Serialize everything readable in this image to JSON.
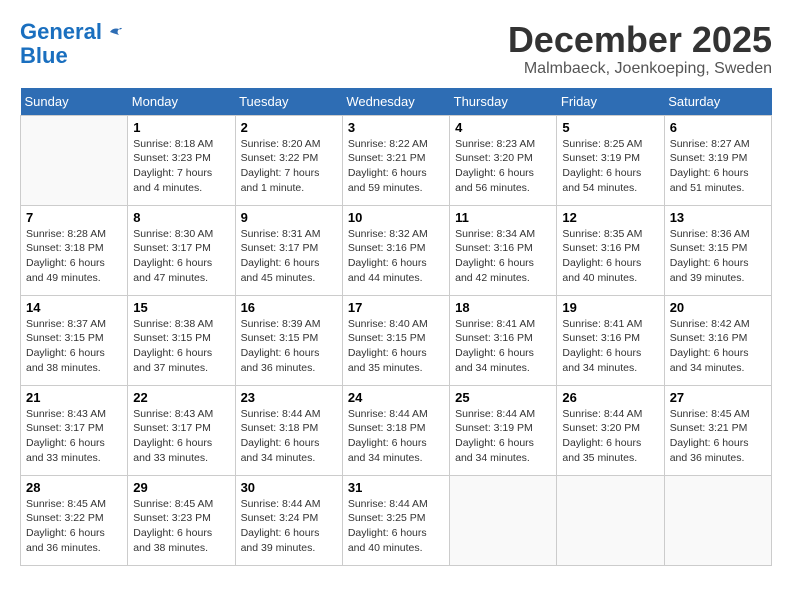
{
  "header": {
    "logo_line1": "General",
    "logo_line2": "Blue",
    "month": "December 2025",
    "location": "Malmbaeck, Joenkoeping, Sweden"
  },
  "days_of_week": [
    "Sunday",
    "Monday",
    "Tuesday",
    "Wednesday",
    "Thursday",
    "Friday",
    "Saturday"
  ],
  "weeks": [
    [
      {
        "day": "",
        "info": ""
      },
      {
        "day": "1",
        "info": "Sunrise: 8:18 AM\nSunset: 3:23 PM\nDaylight: 7 hours\nand 4 minutes."
      },
      {
        "day": "2",
        "info": "Sunrise: 8:20 AM\nSunset: 3:22 PM\nDaylight: 7 hours\nand 1 minute."
      },
      {
        "day": "3",
        "info": "Sunrise: 8:22 AM\nSunset: 3:21 PM\nDaylight: 6 hours\nand 59 minutes."
      },
      {
        "day": "4",
        "info": "Sunrise: 8:23 AM\nSunset: 3:20 PM\nDaylight: 6 hours\nand 56 minutes."
      },
      {
        "day": "5",
        "info": "Sunrise: 8:25 AM\nSunset: 3:19 PM\nDaylight: 6 hours\nand 54 minutes."
      },
      {
        "day": "6",
        "info": "Sunrise: 8:27 AM\nSunset: 3:19 PM\nDaylight: 6 hours\nand 51 minutes."
      }
    ],
    [
      {
        "day": "7",
        "info": "Sunrise: 8:28 AM\nSunset: 3:18 PM\nDaylight: 6 hours\nand 49 minutes."
      },
      {
        "day": "8",
        "info": "Sunrise: 8:30 AM\nSunset: 3:17 PM\nDaylight: 6 hours\nand 47 minutes."
      },
      {
        "day": "9",
        "info": "Sunrise: 8:31 AM\nSunset: 3:17 PM\nDaylight: 6 hours\nand 45 minutes."
      },
      {
        "day": "10",
        "info": "Sunrise: 8:32 AM\nSunset: 3:16 PM\nDaylight: 6 hours\nand 44 minutes."
      },
      {
        "day": "11",
        "info": "Sunrise: 8:34 AM\nSunset: 3:16 PM\nDaylight: 6 hours\nand 42 minutes."
      },
      {
        "day": "12",
        "info": "Sunrise: 8:35 AM\nSunset: 3:16 PM\nDaylight: 6 hours\nand 40 minutes."
      },
      {
        "day": "13",
        "info": "Sunrise: 8:36 AM\nSunset: 3:15 PM\nDaylight: 6 hours\nand 39 minutes."
      }
    ],
    [
      {
        "day": "14",
        "info": "Sunrise: 8:37 AM\nSunset: 3:15 PM\nDaylight: 6 hours\nand 38 minutes."
      },
      {
        "day": "15",
        "info": "Sunrise: 8:38 AM\nSunset: 3:15 PM\nDaylight: 6 hours\nand 37 minutes."
      },
      {
        "day": "16",
        "info": "Sunrise: 8:39 AM\nSunset: 3:15 PM\nDaylight: 6 hours\nand 36 minutes."
      },
      {
        "day": "17",
        "info": "Sunrise: 8:40 AM\nSunset: 3:15 PM\nDaylight: 6 hours\nand 35 minutes."
      },
      {
        "day": "18",
        "info": "Sunrise: 8:41 AM\nSunset: 3:16 PM\nDaylight: 6 hours\nand 34 minutes."
      },
      {
        "day": "19",
        "info": "Sunrise: 8:41 AM\nSunset: 3:16 PM\nDaylight: 6 hours\nand 34 minutes."
      },
      {
        "day": "20",
        "info": "Sunrise: 8:42 AM\nSunset: 3:16 PM\nDaylight: 6 hours\nand 34 minutes."
      }
    ],
    [
      {
        "day": "21",
        "info": "Sunrise: 8:43 AM\nSunset: 3:17 PM\nDaylight: 6 hours\nand 33 minutes."
      },
      {
        "day": "22",
        "info": "Sunrise: 8:43 AM\nSunset: 3:17 PM\nDaylight: 6 hours\nand 33 minutes."
      },
      {
        "day": "23",
        "info": "Sunrise: 8:44 AM\nSunset: 3:18 PM\nDaylight: 6 hours\nand 34 minutes."
      },
      {
        "day": "24",
        "info": "Sunrise: 8:44 AM\nSunset: 3:18 PM\nDaylight: 6 hours\nand 34 minutes."
      },
      {
        "day": "25",
        "info": "Sunrise: 8:44 AM\nSunset: 3:19 PM\nDaylight: 6 hours\nand 34 minutes."
      },
      {
        "day": "26",
        "info": "Sunrise: 8:44 AM\nSunset: 3:20 PM\nDaylight: 6 hours\nand 35 minutes."
      },
      {
        "day": "27",
        "info": "Sunrise: 8:45 AM\nSunset: 3:21 PM\nDaylight: 6 hours\nand 36 minutes."
      }
    ],
    [
      {
        "day": "28",
        "info": "Sunrise: 8:45 AM\nSunset: 3:22 PM\nDaylight: 6 hours\nand 36 minutes."
      },
      {
        "day": "29",
        "info": "Sunrise: 8:45 AM\nSunset: 3:23 PM\nDaylight: 6 hours\nand 38 minutes."
      },
      {
        "day": "30",
        "info": "Sunrise: 8:44 AM\nSunset: 3:24 PM\nDaylight: 6 hours\nand 39 minutes."
      },
      {
        "day": "31",
        "info": "Sunrise: 8:44 AM\nSunset: 3:25 PM\nDaylight: 6 hours\nand 40 minutes."
      },
      {
        "day": "",
        "info": ""
      },
      {
        "day": "",
        "info": ""
      },
      {
        "day": "",
        "info": ""
      }
    ]
  ]
}
